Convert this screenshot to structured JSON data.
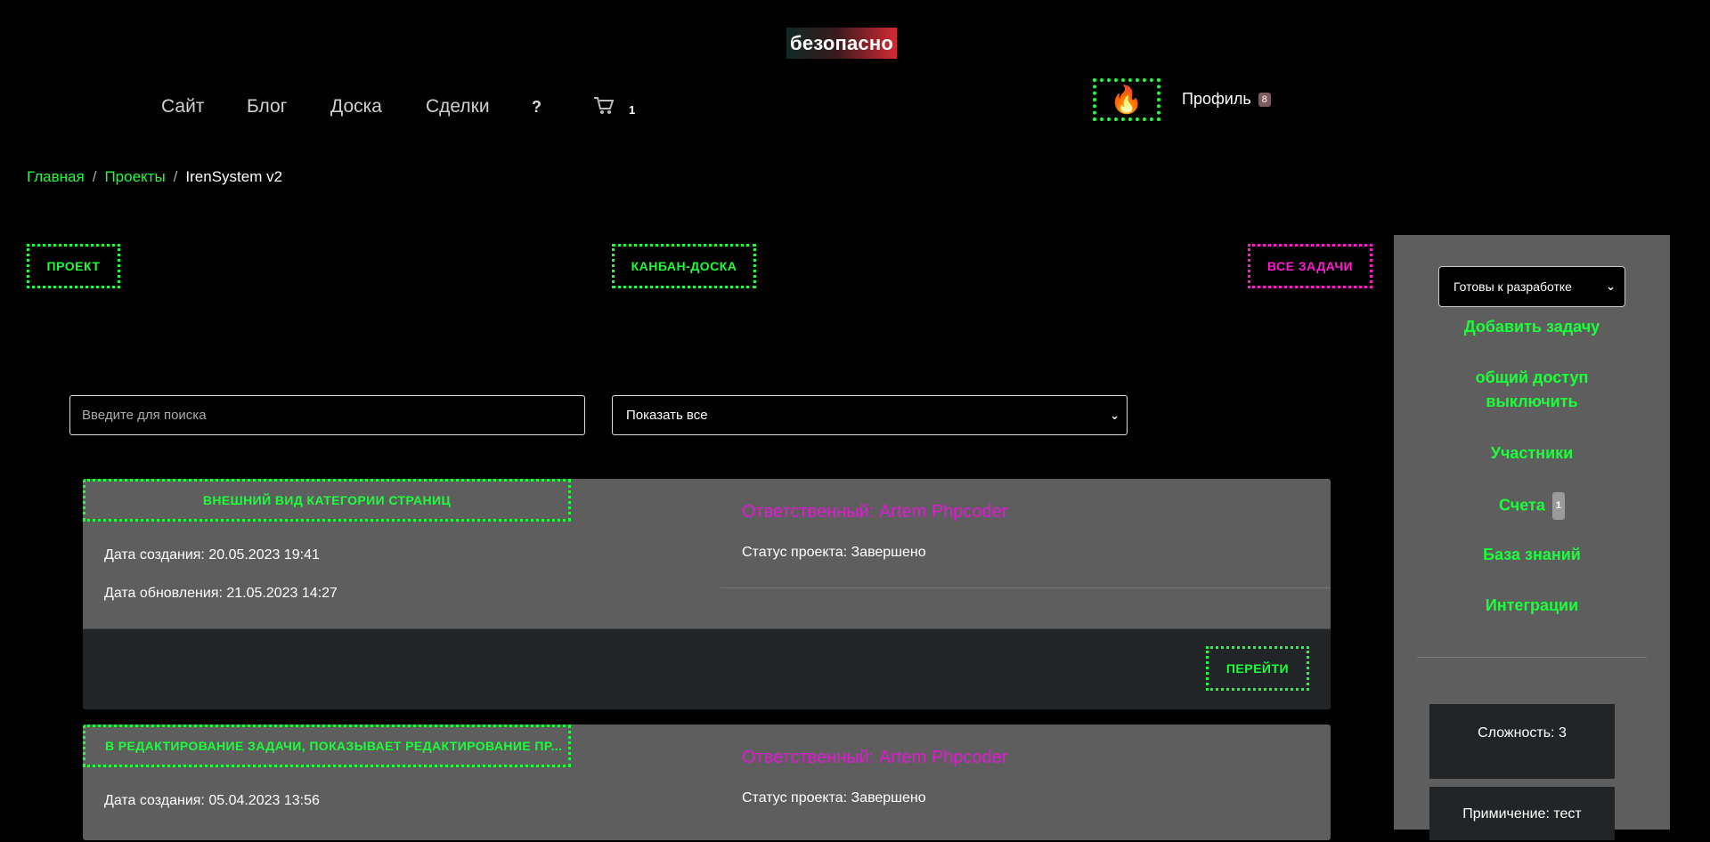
{
  "logo": "безопасно",
  "nav": {
    "items": [
      "Сайт",
      "Блог",
      "Доска",
      "Сделки"
    ],
    "help": "?",
    "cart_icon": "cart-icon",
    "cart_count": "1"
  },
  "header": {
    "fire_icon": "🔥",
    "profile_label": "Профиль",
    "profile_badge": "8"
  },
  "breadcrumb": {
    "home": "Главная",
    "projects": "Проекты",
    "current": "IrenSystem v2",
    "separator": "/"
  },
  "top_buttons": {
    "project": "ПРОЕКТ",
    "kanban": "КАНБАН-ДОСКА",
    "all_tasks": "ВСЕ ЗАДАЧИ"
  },
  "filters": {
    "search_placeholder": "Введите для поиска",
    "show": "Показать все"
  },
  "cards": [
    {
      "title": "ВНЕШНИЙ ВИД КАТЕГОРИИ СТРАНИЦ",
      "created": "Дата создания: 20.05.2023 19:41",
      "updated": "Дата обновления: 21.05.2023 14:27",
      "responsible": "Ответственный: Artem Phpcoder",
      "status": "Статус проекта: Завершено",
      "go_button": "ПЕРЕЙТИ"
    },
    {
      "title": "В РЕДАКТИРОВАНИЕ ЗАДАЧИ, ПОКАЗЫВАЕТ РЕДАКТИРОВАНИЕ ПР...",
      "created": "Дата создания: 05.04.2023 13:56",
      "responsible": "Ответственный: Artem Phpcoder",
      "status": "Статус проекта: Завершено"
    }
  ],
  "sidebar": {
    "status_select": "Готовы к разработке",
    "add_task": "Добавить задачу",
    "share_line1": "общий доступ",
    "share_line2": "выключить",
    "members": "Участники",
    "invoices": "Счета",
    "invoices_badge": "1",
    "knowledge": "База знаний",
    "integrations": "Интеграции",
    "complexity_label": "Сложность:",
    "complexity_value": "3",
    "note_label": "Примичение:",
    "note_value": "тест"
  },
  "colors": {
    "accent_green": "#1aff3a",
    "accent_pink": "#ff1ad0",
    "responsible_pink": "#e01ad0",
    "card_bg": "#5f5e5f",
    "footer_bg": "#222528"
  }
}
